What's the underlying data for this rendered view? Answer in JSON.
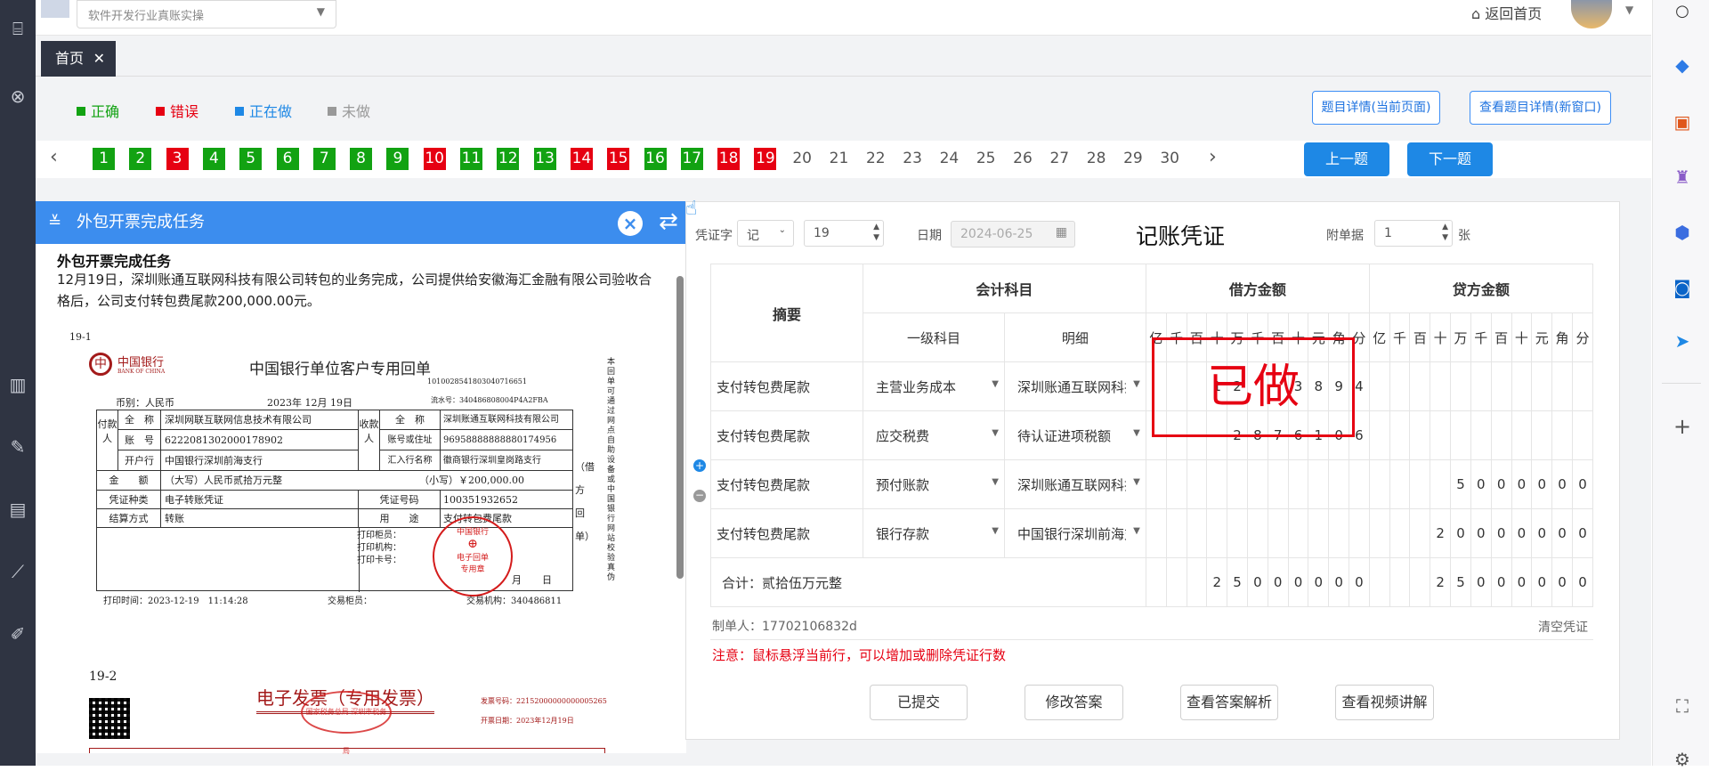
{
  "header": {
    "course_select": "软件开发行业真账实操",
    "return_home": "返回首页"
  },
  "tabs": {
    "home": "首页",
    "close": "✕"
  },
  "legend": {
    "correct": "正确",
    "wrong": "错误",
    "doing": "正在做",
    "undone": "未做",
    "colors": {
      "correct": "#12a212",
      "wrong": "#e60012",
      "doing": "#1e88e5",
      "undone": "#999999"
    }
  },
  "detail_buttons": {
    "current": "题目详情(当前页面)",
    "new_window": "查看题目详情(新窗口)"
  },
  "question_nav": {
    "prev_icon": "chevron-left-icon",
    "next_icon": "chevron-right-icon",
    "items": [
      {
        "n": "1",
        "status": "correct"
      },
      {
        "n": "2",
        "status": "correct"
      },
      {
        "n": "3",
        "status": "wrong"
      },
      {
        "n": "4",
        "status": "correct"
      },
      {
        "n": "5",
        "status": "correct"
      },
      {
        "n": "6",
        "status": "correct"
      },
      {
        "n": "7",
        "status": "correct"
      },
      {
        "n": "8",
        "status": "correct"
      },
      {
        "n": "9",
        "status": "correct"
      },
      {
        "n": "10",
        "status": "wrong"
      },
      {
        "n": "11",
        "status": "correct"
      },
      {
        "n": "12",
        "status": "correct"
      },
      {
        "n": "13",
        "status": "correct"
      },
      {
        "n": "14",
        "status": "wrong"
      },
      {
        "n": "15",
        "status": "wrong"
      },
      {
        "n": "16",
        "status": "correct"
      },
      {
        "n": "17",
        "status": "correct"
      },
      {
        "n": "18",
        "status": "wrong"
      },
      {
        "n": "19",
        "status": "wrong"
      },
      {
        "n": "20",
        "status": "undone"
      },
      {
        "n": "21",
        "status": "undone"
      },
      {
        "n": "22",
        "status": "undone"
      },
      {
        "n": "23",
        "status": "undone"
      },
      {
        "n": "24",
        "status": "undone"
      },
      {
        "n": "25",
        "status": "undone"
      },
      {
        "n": "26",
        "status": "undone"
      },
      {
        "n": "27",
        "status": "undone"
      },
      {
        "n": "28",
        "status": "undone"
      },
      {
        "n": "29",
        "status": "undone"
      },
      {
        "n": "30",
        "status": "undone"
      }
    ],
    "prev_question": "上一题",
    "next_question": "下一题"
  },
  "task": {
    "header": "外包开票完成任务",
    "title": "外包开票完成任务",
    "desc": "12月19日，深圳账通互联网科技有限公司转包的业务完成，公司提供给安徽海汇金融有限公司验收合格后，公司支付转包费尾款200,000.00元。",
    "doc1": {
      "label": "19-1",
      "bank": "中国银行",
      "bank_en": "BANK OF CHINA",
      "title": "中国银行单位客户专用回单",
      "serial": "1010028541803040716651",
      "currency": "币别：人民币",
      "date": "2023年 12月 19日",
      "flow": "流水号：340486808004P4A2FBA",
      "payer_label": "付款人",
      "payee_label": "收款人",
      "full_name_label": "全　称",
      "account_label": "账　号",
      "bank_label": "开户行",
      "payee_acct_label": "账号或住址",
      "payee_bank_label": "汇入行名称",
      "payer_name": "深圳网联互联网信息技术有限公司",
      "payer_acct": "6222081302000178902",
      "payer_bank": "中国银行深圳前海支行",
      "payee_name": "深圳账通互联网科技有限公司",
      "payee_acct": "96958888888880174956",
      "payee_bank": "徽商银行深圳皇岗路支行",
      "amount_label": "金　　额",
      "amount_cn": "（大写）人民币贰拾万元整",
      "amount_num": "（小写）￥200,000.00",
      "vtype_label": "凭证种类",
      "vtype": "电子转账凭证",
      "vno_label": "凭证号码",
      "vno": "100351932652",
      "settle_label": "结算方式",
      "settle": "转账",
      "use_label": "用　　途",
      "use": "支付转包费尾款",
      "print_teller": "打印柜员：",
      "print_org": "打印机构：",
      "print_card": "打印卡号：",
      "stamp_top": "中国银行",
      "stamp_mid": "电子回单",
      "stamp_bot": "专用章",
      "month": "月",
      "day": "日",
      "print_time": "打印时间：2023-12-19　11:14:28",
      "counter": "交易柜员：",
      "org": "交易机构：340486811",
      "side_text": "本回单可通过网点自助设备或中国银行网站校验真伪",
      "side_label": "（借方回单）"
    },
    "doc2": {
      "label": "19-2",
      "title": "电子发票（专用发票）",
      "stamp": "国家税务总局 深圳市税务局",
      "invoice_no": "发票号码：22152000000000005265",
      "invoice_date": "开票日期：2023年12月19日"
    }
  },
  "voucher": {
    "word_label": "凭证字",
    "word": "记",
    "number": "19",
    "date_label": "日期",
    "date_placeholder": "2024-06-25",
    "title": "记账凭证",
    "attach_label": "附单据",
    "attach": "1",
    "attach_unit": "张",
    "headers": {
      "summary": "摘要",
      "account": "会计科目",
      "level1": "一级科目",
      "detail": "明细",
      "debit": "借方金额",
      "credit": "贷方金额"
    },
    "digit_headers": [
      "亿",
      "千",
      "百",
      "十",
      "万",
      "千",
      "百",
      "十",
      "元",
      "角",
      "分"
    ],
    "rows": [
      {
        "summary": "支付转包费尾款",
        "level1": "主营业务成本",
        "detail": "深圳账通互联网科技",
        "debit": [
          "",
          "",
          "",
          "1",
          "2",
          "",
          "",
          "3",
          "8",
          "9",
          "4"
        ],
        "credit": [
          "",
          "",
          "",
          "",
          "",
          "",
          "",
          "",
          "",
          "",
          ""
        ]
      },
      {
        "summary": "支付转包费尾款",
        "level1": "应交税费",
        "detail": "待认证进项税额",
        "debit": [
          "",
          "",
          "",
          "",
          "2",
          "8",
          "7",
          "6",
          "1",
          "0",
          "6"
        ],
        "credit": [
          "",
          "",
          "",
          "",
          "",
          "",
          "",
          "",
          "",
          "",
          ""
        ]
      },
      {
        "summary": "支付转包费尾款",
        "level1": "预付账款",
        "detail": "深圳账通互联网科技",
        "debit": [
          "",
          "",
          "",
          "",
          "",
          "",
          "",
          "",
          "",
          "",
          ""
        ],
        "credit": [
          "",
          "",
          "",
          "",
          "5",
          "0",
          "0",
          "0",
          "0",
          "0",
          "0"
        ]
      },
      {
        "summary": "支付转包费尾款",
        "level1": "银行存款",
        "detail": "中国银行深圳前海支",
        "debit": [
          "",
          "",
          "",
          "",
          "",
          "",
          "",
          "",
          "",
          "",
          ""
        ],
        "credit": [
          "",
          "",
          "",
          "2",
          "0",
          "0",
          "0",
          "0",
          "0",
          "0",
          "0"
        ]
      }
    ],
    "total_label": "合计：贰拾伍万元整",
    "total_debit": [
      "",
      "",
      "",
      "2",
      "5",
      "0",
      "0",
      "0",
      "0",
      "0",
      "0"
    ],
    "total_credit": [
      "",
      "",
      "",
      "2",
      "5",
      "0",
      "0",
      "0",
      "0",
      "0",
      "0"
    ],
    "maker": "制单人：17702106832d",
    "clear": "清空凭证",
    "note": "注意：鼠标悬浮当前行，可以增加或删除凭证行数",
    "stamp": "已做",
    "actions": [
      "已提交",
      "修改答案",
      "查看答案解析",
      "查看视频讲解"
    ]
  }
}
